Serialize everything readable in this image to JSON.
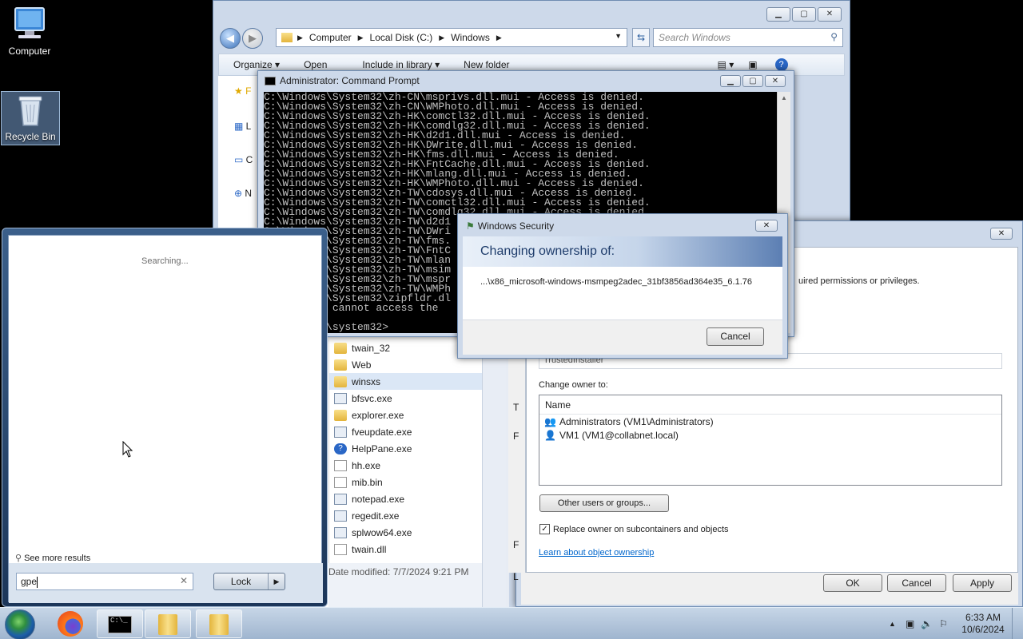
{
  "desktop": {
    "computer_label": "Computer",
    "recycle_label": "Recycle Bin"
  },
  "explorer": {
    "breadcrumbs": [
      "Computer",
      "Local Disk (C:)",
      "Windows"
    ],
    "search_placeholder": "Search Windows",
    "toolbar": {
      "organize": "Organize ▾",
      "open": "Open",
      "include": "Include in library ▾",
      "new_folder": "New folder"
    },
    "nav_items": [
      "F",
      "L",
      "C",
      "N"
    ],
    "files": [
      {
        "name": "twain_32",
        "icon": "folder-icon"
      },
      {
        "name": "Web",
        "icon": "folder-icon"
      },
      {
        "name": "winsxs",
        "icon": "folder-icon"
      },
      {
        "name": "bfsvc.exe",
        "icon": "exe-icon"
      },
      {
        "name": "explorer.exe",
        "icon": "explorer-icon"
      },
      {
        "name": "fveupdate.exe",
        "icon": "exe-icon"
      },
      {
        "name": "HelpPane.exe",
        "icon": "help-icon"
      },
      {
        "name": "hh.exe",
        "icon": "help-doc-icon"
      },
      {
        "name": "mib.bin",
        "icon": "doc-icon"
      },
      {
        "name": "notepad.exe",
        "icon": "notepad-icon"
      },
      {
        "name": "regedit.exe",
        "icon": "regedit-icon"
      },
      {
        "name": "splwow64.exe",
        "icon": "exe-icon"
      },
      {
        "name": "twain.dll",
        "icon": "doc-icon"
      }
    ],
    "details_modified": "Date modified: 7/7/2024 9:21 PM"
  },
  "cmd": {
    "title": "Administrator: Command Prompt",
    "lines": [
      "C:\\Windows\\System32\\zh-CN\\msprivs.dll.mui - Access is denied.",
      "C:\\Windows\\System32\\zh-CN\\WMPhoto.dll.mui - Access is denied.",
      "C:\\Windows\\System32\\zh-HK\\comctl32.dll.mui - Access is denied.",
      "C:\\Windows\\System32\\zh-HK\\comdlg32.dll.mui - Access is denied.",
      "C:\\Windows\\System32\\zh-HK\\d2d1.dll.mui - Access is denied.",
      "C:\\Windows\\System32\\zh-HK\\DWrite.dll.mui - Access is denied.",
      "C:\\Windows\\System32\\zh-HK\\fms.dll.mui - Access is denied.",
      "C:\\Windows\\System32\\zh-HK\\FntCache.dll.mui - Access is denied.",
      "C:\\Windows\\System32\\zh-HK\\mlang.dll.mui - Access is denied.",
      "C:\\Windows\\System32\\zh-HK\\WMPhoto.dll.mui - Access is denied.",
      "C:\\Windows\\System32\\zh-TW\\cdosys.dll.mui - Access is denied.",
      "C:\\Windows\\System32\\zh-TW\\comctl32.dll.mui - Access is denied.",
      "C:\\Windows\\System32\\zh-TW\\comdlg32.dll.mui - Access is denied.",
      "C:\\Windows\\System32\\zh-TW\\d2d1",
      "C:\\Windows\\System32\\zh-TW\\DWri",
      "C:\\Windows\\System32\\zh-TW\\fms.",
      "C:\\Windows\\System32\\zh-TW\\FntC",
      "C:\\Windows\\System32\\zh-TW\\mlan",
      "C:\\Windows\\System32\\zh-TW\\msim",
      "C:\\Windows\\System32\\zh-TW\\mspr",
      "C:\\Windows\\System32\\zh-TW\\WMPh",
      "C:\\Windows\\System32\\zipfldr.dl",
      "The system cannot access the",
      "",
      "C:\\Windows\\system32>"
    ]
  },
  "security_dialog": {
    "title": "Windows Security",
    "heading": "Changing ownership of:",
    "path": "...\\x86_microsoft-windows-msmpeg2adec_31bf3856ad364e35_6.1.76",
    "cancel": "Cancel"
  },
  "advanced": {
    "perm_text": "uired permissions or privileges.",
    "current_owner": "TrustedInstaller",
    "change_owner_label": "Change owner to:",
    "column_name": "Name",
    "owners": [
      "Administrators (VM1\\Administrators)",
      "VM1 (VM1@collabnet.local)"
    ],
    "other_users": "Other users or groups...",
    "replace_owner": "Replace owner on subcontainers and objects",
    "learn_link": "Learn about object ownership",
    "ok": "OK",
    "cancel": "Cancel",
    "apply": "Apply",
    "left_letters": [
      "T",
      "F",
      "F",
      "L"
    ]
  },
  "start_menu": {
    "searching": "Searching...",
    "see_more": "See more results",
    "search_value": "gpe",
    "lock": "Lock"
  },
  "taskbar": {
    "time": "6:33 AM",
    "date": "10/6/2024"
  }
}
